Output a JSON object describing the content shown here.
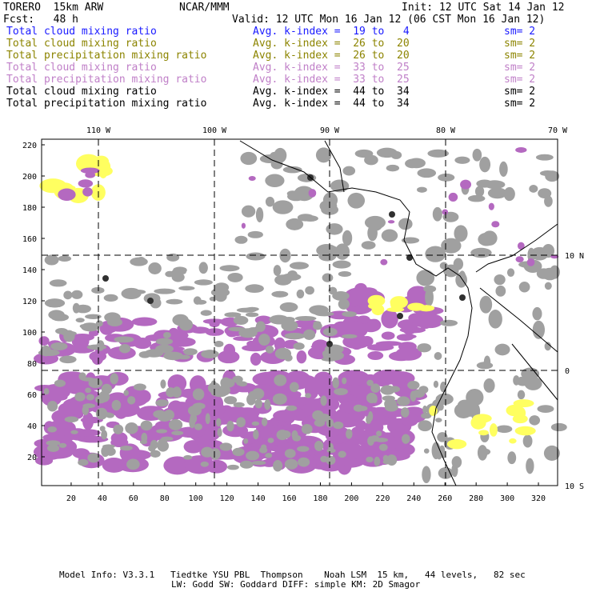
{
  "header": {
    "model": "TORERO  15km ARW",
    "org": "NCAR/MMM",
    "init": "Init: 12 UTC Sat 14 Jan 12",
    "fcst": "Fcst:   48 h",
    "valid": "Valid: 12 UTC Mon 16 Jan 12 (06 CST Mon 16 Jan 12)"
  },
  "legend": [
    {
      "field": "Total cloud mixing ratio",
      "kindex": "Avg. k-index =  19 to   4",
      "sm": "sm= 2",
      "color": "#1a1aff"
    },
    {
      "field": "Total cloud mixing ratio",
      "kindex": "Avg. k-index =  26 to  20",
      "sm": "sm= 2",
      "color": "#8c8400"
    },
    {
      "field": "Total precipitation mixing ratio",
      "kindex": "Avg. k-index =  26 to  20",
      "sm": "sm= 2",
      "color": "#8c8400"
    },
    {
      "field": "Total cloud mixing ratio",
      "kindex": "Avg. k-index =  33 to  25",
      "sm": "sm= 2",
      "color": "#c080c8"
    },
    {
      "field": "Total precipitation mixing ratio",
      "kindex": "Avg. k-index =  33 to  25",
      "sm": "sm= 2",
      "color": "#c080c8"
    },
    {
      "field": "Total cloud mixing ratio",
      "kindex": "Avg. k-index =  44 to  34",
      "sm": "sm= 2",
      "color": "#000000"
    },
    {
      "field": "Total precipitation mixing ratio",
      "kindex": "Avg. k-index =  44 to  34",
      "sm": "sm= 2",
      "color": "#000000"
    }
  ],
  "map": {
    "lon_labels": [
      "110 W",
      "100 W",
      "90 W",
      "80 W",
      "70 W"
    ],
    "lat_labels": [
      "10 N",
      "0",
      "10 S"
    ],
    "x_ticks": [
      "20",
      "40",
      "60",
      "80",
      "100",
      "120",
      "140",
      "160",
      "180",
      "200",
      "220",
      "240",
      "260",
      "280",
      "300",
      "320"
    ],
    "y_ticks": [
      "20",
      "40",
      "60",
      "80",
      "100",
      "120",
      "140",
      "160",
      "180",
      "200",
      "220"
    ],
    "colors": {
      "gray": "#a0a0a0",
      "purple": "#b469c0",
      "yellow": "#ffff60",
      "cyan": "#c8f0ff"
    }
  },
  "footer": {
    "line1": "Model Info: V3.3.1   Tiedtke YSU PBL  Thompson    Noah LSM  15 km,   44 levels,   82 sec",
    "line2": "LW: Godd SW: Goddard DIFF: simple KM: 2D Smagor"
  }
}
